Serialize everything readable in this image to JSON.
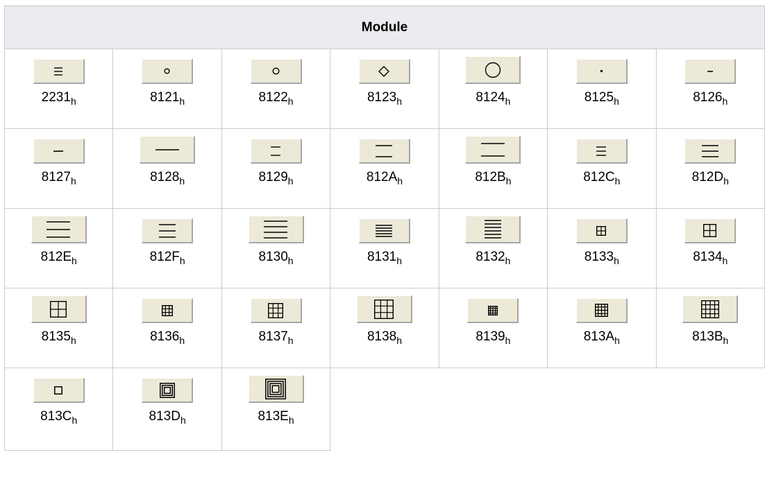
{
  "header": {
    "title": "Module"
  },
  "subscript": "h",
  "rows": [
    [
      {
        "code": "2231",
        "icon": "three-lines-small-icon"
      },
      {
        "code": "8121",
        "icon": "tiny-circle-icon"
      },
      {
        "code": "8122",
        "icon": "small-circle-icon"
      },
      {
        "code": "8123",
        "icon": "diamond-icon"
      },
      {
        "code": "8124",
        "icon": "large-circle-icon"
      },
      {
        "code": "8125",
        "icon": "dot-icon"
      },
      {
        "code": "8126",
        "icon": "short-dash-icon"
      }
    ],
    [
      {
        "code": "8127",
        "icon": "dash-icon"
      },
      {
        "code": "8128",
        "icon": "long-line-icon"
      },
      {
        "code": "8129",
        "icon": "two-short-lines-icon"
      },
      {
        "code": "812A",
        "icon": "two-lines-icon"
      },
      {
        "code": "812B",
        "icon": "two-long-lines-icon"
      },
      {
        "code": "812C",
        "icon": "three-short-lines-icon"
      },
      {
        "code": "812D",
        "icon": "three-lines-icon"
      }
    ],
    [
      {
        "code": "812E",
        "icon": "three-wide-lines-icon"
      },
      {
        "code": "812F",
        "icon": "three-medium-lines-icon"
      },
      {
        "code": "8130",
        "icon": "four-lines-icon"
      },
      {
        "code": "8131",
        "icon": "five-lines-icon"
      },
      {
        "code": "8132",
        "icon": "six-lines-icon"
      },
      {
        "code": "8133",
        "icon": "small-grid-2x2-icon"
      },
      {
        "code": "8134",
        "icon": "grid-2x2-icon"
      }
    ],
    [
      {
        "code": "8135",
        "icon": "large-grid-2x2-icon"
      },
      {
        "code": "8136",
        "icon": "small-grid-3x3-icon"
      },
      {
        "code": "8137",
        "icon": "grid-3x3-icon"
      },
      {
        "code": "8138",
        "icon": "large-grid-3x3-icon"
      },
      {
        "code": "8139",
        "icon": "small-grid-4x4-icon"
      },
      {
        "code": "813A",
        "icon": "grid-4x4-icon"
      },
      {
        "code": "813B",
        "icon": "large-grid-4x4-icon"
      }
    ],
    [
      {
        "code": "813C",
        "icon": "small-spiral-icon"
      },
      {
        "code": "813D",
        "icon": "spiral-icon"
      },
      {
        "code": "813E",
        "icon": "large-spiral-icon"
      }
    ]
  ]
}
